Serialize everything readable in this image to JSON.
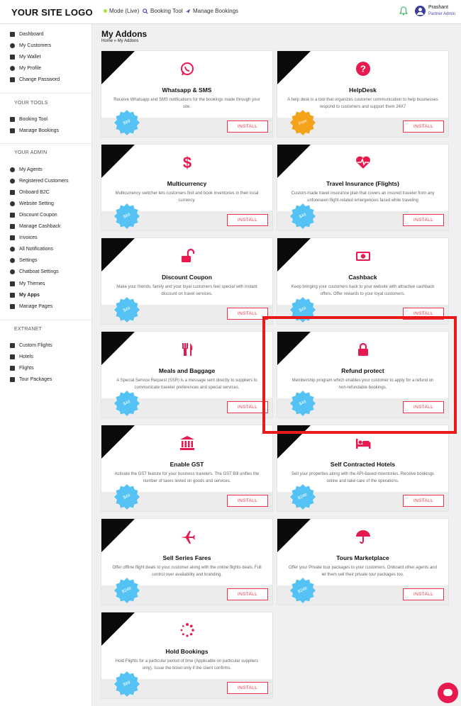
{
  "header": {
    "logo": "YOUR SITE LOGO",
    "mode": "Mode (Live)",
    "booking_tool": "Booking Tool",
    "manage_bookings": "Manage Bookings",
    "user_name": "Prashant",
    "user_role": "Partner Admin"
  },
  "sidebar": {
    "main_items": [
      {
        "label": "Dashboard",
        "icon": "dashboard-icon"
      },
      {
        "label": "My Customers",
        "icon": "user-icon"
      },
      {
        "label": "My Wallet",
        "icon": "wallet-icon"
      },
      {
        "label": "My Profile",
        "icon": "profile-icon"
      },
      {
        "label": "Change Password",
        "icon": "lock-icon"
      }
    ],
    "tools_title": "YOUR TOOLS",
    "tools_items": [
      {
        "label": "Booking Tool",
        "icon": "search-icon"
      },
      {
        "label": "Manage Bookings",
        "icon": "plane-icon"
      }
    ],
    "admin_title": "YOUR ADMIN",
    "admin_items": [
      {
        "label": "My Agents",
        "icon": "users-icon"
      },
      {
        "label": "Registered Customers",
        "icon": "users-icon"
      },
      {
        "label": "Onboard B2C",
        "icon": "document-icon"
      },
      {
        "label": "Website Setting",
        "icon": "gears-icon"
      },
      {
        "label": "Discount Coupon",
        "icon": "tag-icon"
      },
      {
        "label": "Manage Cashback",
        "icon": "tags-icon"
      },
      {
        "label": "Invoices",
        "icon": "invoice-icon"
      },
      {
        "label": "All Notifications",
        "icon": "bell-icon"
      },
      {
        "label": "Settings",
        "icon": "gear-icon"
      },
      {
        "label": "Chatboat Settings",
        "icon": "gears-icon"
      },
      {
        "label": "My Themes",
        "icon": "theme-icon"
      },
      {
        "label": "My Apps",
        "icon": "rocket-icon",
        "active": true
      },
      {
        "label": "Manage Pages",
        "icon": "pages-icon"
      }
    ],
    "extranet_title": "EXTRANET",
    "extranet_items": [
      {
        "label": "Custom Flights",
        "icon": "bed-icon"
      },
      {
        "label": "Hotels",
        "icon": "bed-icon"
      },
      {
        "label": "Flights",
        "icon": "flight-icon"
      },
      {
        "label": "Tour Packages",
        "icon": "camera-icon"
      }
    ]
  },
  "main": {
    "title": "My Addons",
    "breadcrumb": "Home » My Addons",
    "install_label": "INSTALL",
    "accent_color": "#e8194f",
    "addons": [
      {
        "title": "Whatsapp & SMS",
        "desc": "Receive Whatsapp and SMS notifications for the bookings made through your site.",
        "price": "$99",
        "icon": "whatsapp-icon"
      },
      {
        "title": "HelpDesk",
        "desc": "A help desk is a tool that organizes customer communication to help businesses respond to customers and support them 24X7",
        "price": "Free",
        "icon": "question-icon"
      },
      {
        "title": "Multicurrency",
        "desc": "Multicurrency switcher lets customers find and book inventories in their local currency.",
        "price": "$69",
        "icon": "dollar-icon"
      },
      {
        "title": "Travel Insurance (Flights)",
        "desc": "Custom-made travel insurance plan that covers an insured traveler from any unforeseen flight-related emergencies faced while traveling",
        "price": "$49",
        "icon": "heartbeat-icon"
      },
      {
        "title": "Discount Coupon",
        "desc": "Make your friends, family and your loyal customers feel special with instant discount on travel services.",
        "price": "$49",
        "icon": "unlock-icon"
      },
      {
        "title": "Cashback",
        "desc": "Keep bringing your customers back to your website with attractive cashback offers. Offer rewards to your loyal customers.",
        "price": "$49",
        "icon": "money-icon"
      },
      {
        "title": "Meals and Baggage",
        "desc": "A Special Service Request (SSR) is a message sent directly to suppliers to communicate traveler preferences and special services.",
        "price": "$49",
        "icon": "utensils-icon"
      },
      {
        "title": "Refund protect",
        "desc": "Membership program which enables your customer to apply for a refund on non-refundable bookings.",
        "price": "$49",
        "icon": "lock-icon"
      },
      {
        "title": "Enable GST",
        "desc": "Activate the GST feature for your business travelers. The GST Bill unifies the number of taxes levied on goods and services.",
        "price": "$49",
        "icon": "bank-icon"
      },
      {
        "title": "Self Contracted Hotels",
        "desc": "Sell your properties along with the API-based inventories. Receive bookings online and take care of the operations.",
        "price": "$249",
        "icon": "bed-icon"
      },
      {
        "title": "Sell Series Fares",
        "desc": "Offer offline flight deals to your customer along with the online flights deals. Full control over availability and branding.",
        "price": "$249",
        "icon": "plane-icon"
      },
      {
        "title": "Tours Marketplace",
        "desc": "Offer your Private tour packages to your customers. Onboard other agents and let them sell their private tour packages too.",
        "price": "$249",
        "icon": "umbrella-icon"
      },
      {
        "title": "Hold Bookings",
        "desc": "Hold Flights for a particular period of time (Applicable on particular suppliers only). Issue the ticket only if the client confirms.",
        "price": "$99",
        "icon": "spinner-icon"
      }
    ]
  }
}
